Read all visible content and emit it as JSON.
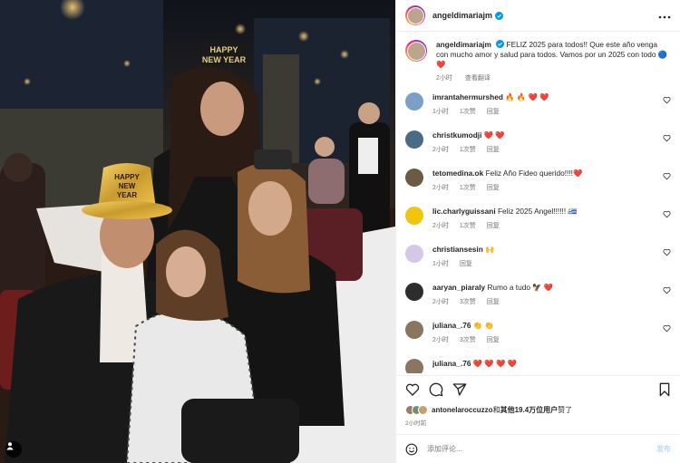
{
  "header": {
    "username": "angeldimariajm"
  },
  "caption": {
    "username": "angeldimariajm",
    "text": "FELIZ 2025 para todos!! Que este año venga con mucho amor y salud para todos. Vamos por un 2025 con todo 🔵 ❤️",
    "time": "2小时",
    "translate": "查看翻译"
  },
  "comments": [
    {
      "username": "imrantahermurshed",
      "text": "🔥 🔥 ❤️ ❤️",
      "time": "1小时",
      "likes": "1次赞",
      "reply": "回复",
      "avatar_color": "#7aa0c8"
    },
    {
      "username": "christkumodji",
      "text": "❤️ ❤️",
      "time": "2小时",
      "likes": "1次赞",
      "reply": "回复",
      "avatar_color": "#4a6a85"
    },
    {
      "username": "tetomedina.ok",
      "text": "Feliz Año Fideo querido!!!!❤️",
      "time": "2小时",
      "likes": "1次赞",
      "reply": "回复",
      "avatar_color": "#6b5a44"
    },
    {
      "username": "lic.charlyguissani",
      "text": "Feliz 2025 Angel!!!!!! 🇺🇾",
      "time": "2小时",
      "likes": "1次赞",
      "reply": "回复",
      "avatar_color": "#f1c40f"
    },
    {
      "username": "christiansesin",
      "text": "🙌",
      "time": "1小时",
      "likes": "",
      "reply": "回复",
      "avatar_color": "#d6c7e8"
    },
    {
      "username": "aaryan_piaraly",
      "text": "Rumo a tudo 🦅 ❤️",
      "time": "2小时",
      "likes": "3次赞",
      "reply": "回复",
      "avatar_color": "#2d2d2d"
    },
    {
      "username": "juliana_.76",
      "text": "👏 👏",
      "time": "2小时",
      "likes": "3次赞",
      "reply": "回复",
      "avatar_color": "#8a7560"
    },
    {
      "username": "juliana_.76",
      "text": "❤️ ❤️ ❤️ ❤️",
      "time": "",
      "likes": "",
      "reply": "",
      "avatar_color": "#8a7560"
    }
  ],
  "likes": {
    "prefix_user": "antonelaroccuzzo",
    "connector": "和",
    "others": "其他19.4万位用户",
    "suffix": "赞了"
  },
  "posted_time": "2小时前",
  "add_comment": {
    "placeholder": "添加评论...",
    "post_label": "发布"
  },
  "colors": {
    "accent": "#0095f6",
    "heart": "#ed4956",
    "muted": "#737373"
  },
  "icons": [
    "more-icon",
    "verified-icon",
    "heart-icon",
    "comment-icon",
    "share-icon",
    "save-icon",
    "emoji-icon",
    "user-tag-icon"
  ]
}
